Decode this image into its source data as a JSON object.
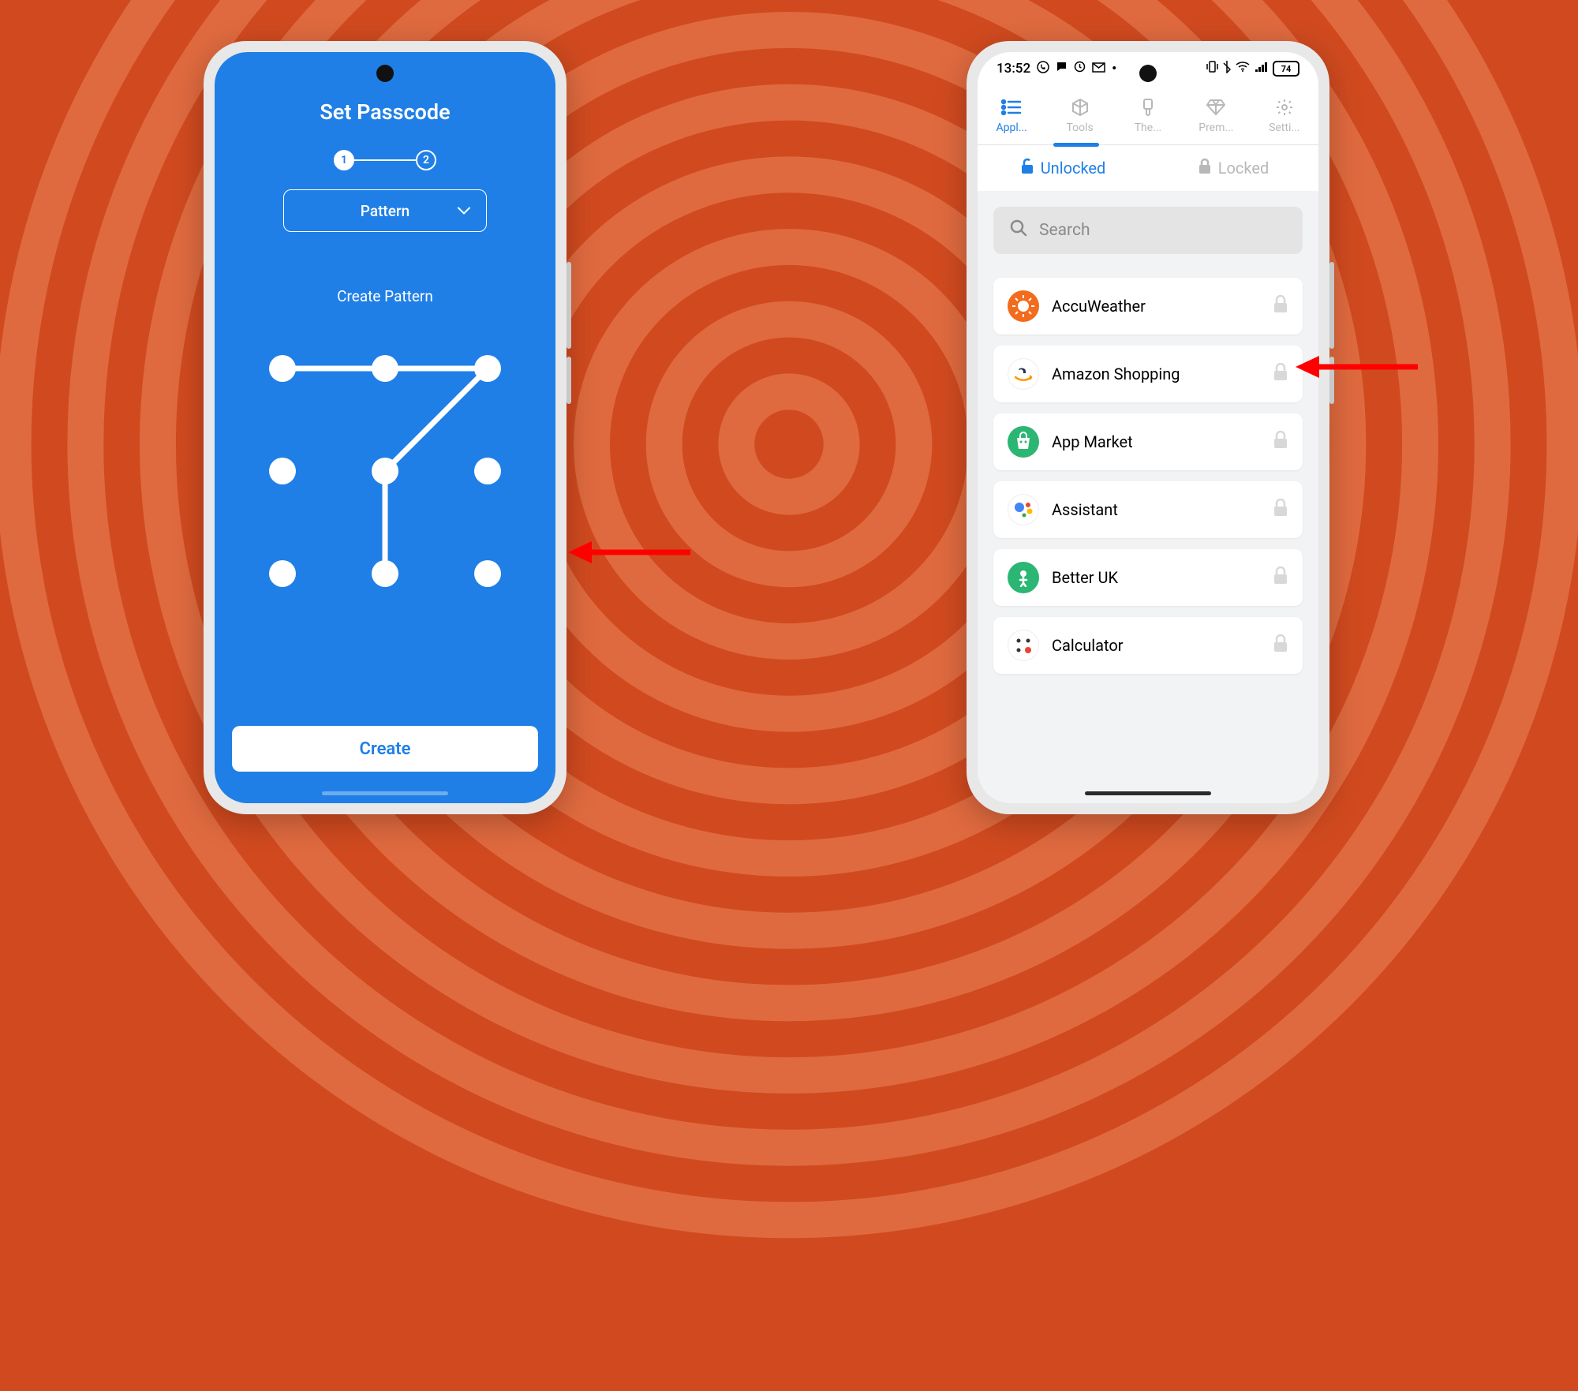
{
  "phone1": {
    "title": "Set Passcode",
    "step1": "1",
    "step2": "2",
    "dropdown_label": "Pattern",
    "subtitle": "Create Pattern",
    "create_button": "Create",
    "pattern_dots": [
      [
        0,
        0
      ],
      [
        1,
        0
      ],
      [
        2,
        0
      ],
      [
        0,
        1
      ],
      [
        1,
        1
      ],
      [
        2,
        1
      ],
      [
        0,
        2
      ],
      [
        1,
        2
      ],
      [
        2,
        2
      ]
    ],
    "pattern_path": [
      [
        0,
        0
      ],
      [
        1,
        0
      ],
      [
        2,
        0
      ],
      [
        1,
        1
      ],
      [
        1,
        2
      ]
    ]
  },
  "phone2": {
    "status": {
      "time": "13:52",
      "battery": "74"
    },
    "top_tabs": [
      {
        "label": "Appl...",
        "active": true
      },
      {
        "label": "Tools",
        "active": false
      },
      {
        "label": "The...",
        "active": false
      },
      {
        "label": "Prem...",
        "active": false
      },
      {
        "label": "Setti...",
        "active": false
      }
    ],
    "seg_tabs": {
      "unlocked": "Unlocked",
      "locked": "Locked"
    },
    "search_placeholder": "Search",
    "apps": [
      {
        "name": "AccuWeather",
        "color": "#f36b1c"
      },
      {
        "name": "Amazon Shopping",
        "color": "#f7d65a"
      },
      {
        "name": "App Market",
        "color": "#2bb673"
      },
      {
        "name": "Assistant",
        "color": "#ffffff"
      },
      {
        "name": "Better UK",
        "color": "#2bb673"
      },
      {
        "name": "Calculator",
        "color": "#ffffff"
      }
    ]
  }
}
